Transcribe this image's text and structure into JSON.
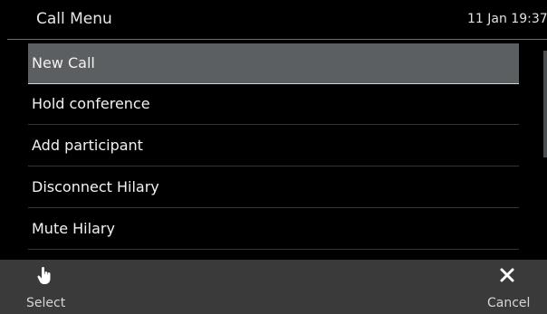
{
  "header": {
    "title": "Call Menu",
    "datetime": "11 Jan 19:37"
  },
  "menu": {
    "items": [
      {
        "label": "New Call",
        "selected": true
      },
      {
        "label": "Hold conference",
        "selected": false
      },
      {
        "label": "Add participant",
        "selected": false
      },
      {
        "label": "Disconnect Hilary",
        "selected": false
      },
      {
        "label": "Mute Hilary",
        "selected": false
      }
    ]
  },
  "softkeys": {
    "select": {
      "label": "Select",
      "icon": "hand-pointer-icon"
    },
    "cancel": {
      "label": "Cancel",
      "icon": "close-icon"
    }
  },
  "colors": {
    "background": "#000000",
    "header_line": "#3a7fa8",
    "selected_row": "#5c5f61",
    "row_divider": "#17404a",
    "softkey_bar": "#3a3a3a"
  }
}
